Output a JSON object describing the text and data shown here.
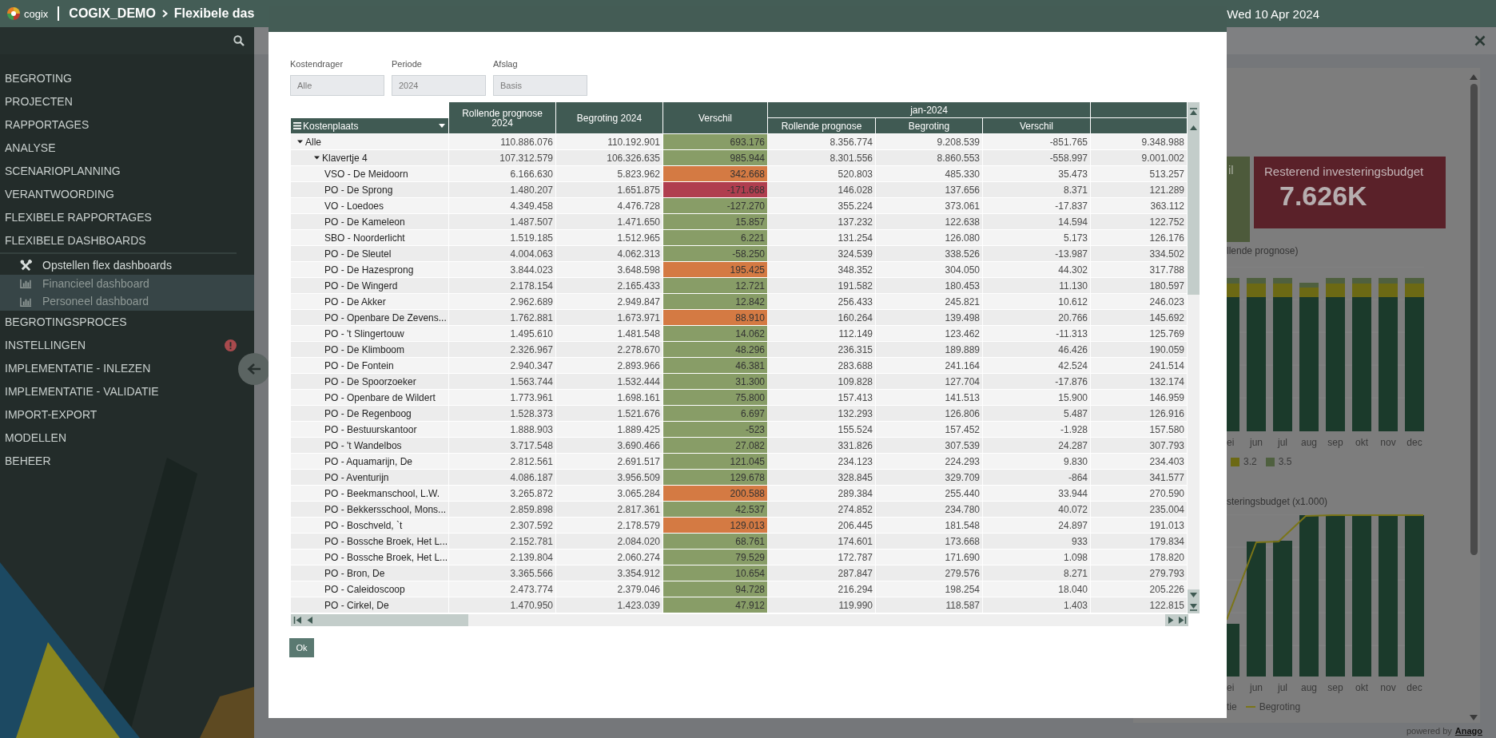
{
  "top_bar": {
    "logo_text": "cogix",
    "environment": "COGIX_DEMO",
    "page_title": "Flexibele das",
    "date": "Wed 10 Apr 2024"
  },
  "sidebar": {
    "items": [
      {
        "label": "BEGROTING",
        "alert": false
      },
      {
        "label": "PROJECTEN",
        "alert": false
      },
      {
        "label": "RAPPORTAGES",
        "alert": false
      },
      {
        "label": "ANALYSE",
        "alert": false
      },
      {
        "label": "SCENARIOPLANNING",
        "alert": false
      },
      {
        "label": "VERANTWOORDING",
        "alert": false
      },
      {
        "label": "FLEXIBELE RAPPORTAGES",
        "alert": false
      },
      {
        "label": "FLEXIBELE DASHBOARDS",
        "alert": false,
        "children": [
          {
            "label": "Opstellen flex dashboards",
            "kind": "tool",
            "selected": false
          },
          {
            "label": "Financieel dashboard",
            "kind": "chart",
            "selected": true
          },
          {
            "label": "Personeel dashboard",
            "kind": "chart",
            "selected": true
          }
        ]
      },
      {
        "label": "BEGROTINGSPROCES",
        "alert": false
      },
      {
        "label": "INSTELLINGEN",
        "alert": true
      },
      {
        "label": "IMPLEMENTATIE - INLEZEN",
        "alert": false
      },
      {
        "label": "IMPLEMENTATIE - VALIDATIE",
        "alert": false
      },
      {
        "label": "IMPORT-EXPORT",
        "alert": false
      },
      {
        "label": "MODELLEN",
        "alert": false
      },
      {
        "label": "BEHEER",
        "alert": false
      }
    ]
  },
  "dashboard": {
    "kpi_cards": [
      {
        "title": "il",
        "color": "#4d5a3b"
      },
      {
        "title": "Resterend investeringsbudget",
        "value": "7.626K",
        "color": "#5a2129"
      }
    ],
    "charts": [
      {
        "kind": "stacked",
        "title": "llende prognose)",
        "months": [
          "ei",
          "jun",
          "jul",
          "aug",
          "sep",
          "okt",
          "nov",
          "dec"
        ],
        "legend": [
          {
            "label": "3.2",
            "kind": "box",
            "color": "#6c6914"
          },
          {
            "label": "3.5",
            "kind": "box",
            "color": "#4f603f"
          }
        ]
      },
      {
        "kind": "combo",
        "title": "steringsbudget (x1.000)",
        "months": [
          "ei",
          "jun",
          "jul",
          "aug",
          "sep",
          "okt",
          "nov",
          "dec"
        ],
        "legend": [
          {
            "label": "tie",
            "kind": "text"
          },
          {
            "label": "Begroting",
            "kind": "line",
            "color": "#7b7518"
          }
        ]
      }
    ],
    "footer": {
      "prefix": "powered by",
      "link": "Anago"
    }
  },
  "modal": {
    "filters": [
      {
        "label": "Kostendrager",
        "value": "Alle"
      },
      {
        "label": "Periode",
        "value": "2024"
      },
      {
        "label": "Afslag",
        "value": "Basis"
      }
    ],
    "table": {
      "row_header": "Kostenplaats",
      "columns": [
        "Rollende prognose 2024",
        "Begroting 2024",
        "Verschil"
      ],
      "group_header": "jan-2024",
      "group_columns": [
        "Rollende prognose",
        "Begroting",
        "Verschil"
      ],
      "rows": [
        {
          "name": "Alle",
          "expanded": true,
          "values": [
            "110.886.076",
            "110.192.901",
            "693.176",
            "8.356.774",
            "9.208.539",
            "-851.765",
            "9.348.988"
          ],
          "color": "#889d67",
          "children": [
            {
              "name": "Klavertje 4",
              "expanded": true,
              "values": [
                "107.312.579",
                "106.326.635",
                "985.944",
                "8.301.556",
                "8.860.553",
                "-558.997",
                "9.001.002"
              ],
              "color": "#889d67",
              "children": [
                {
                  "name": "VSO - De Meidoorn",
                  "values": [
                    "6.166.630",
                    "5.823.962",
                    "342.668",
                    "520.803",
                    "485.330",
                    "35.473",
                    "513.257"
                  ],
                  "color": "#d47a43"
                },
                {
                  "name": "PO - De Sprong",
                  "values": [
                    "1.480.207",
                    "1.651.875",
                    "-171.668",
                    "146.028",
                    "137.656",
                    "8.371",
                    "121.289"
                  ],
                  "color": "#b03e4f"
                },
                {
                  "name": "VO - Loedoes",
                  "values": [
                    "4.349.458",
                    "4.476.728",
                    "-127.270",
                    "355.224",
                    "373.061",
                    "-17.837",
                    "363.112"
                  ],
                  "color": "#889d67"
                },
                {
                  "name": "PO - De Kameleon",
                  "values": [
                    "1.487.507",
                    "1.471.650",
                    "15.857",
                    "137.232",
                    "122.638",
                    "14.594",
                    "122.752"
                  ],
                  "color": "#889d67"
                },
                {
                  "name": "SBO - Noorderlicht",
                  "values": [
                    "1.519.185",
                    "1.512.965",
                    "6.221",
                    "131.254",
                    "126.080",
                    "5.173",
                    "126.176"
                  ],
                  "color": "#889d67"
                },
                {
                  "name": "PO - De Sleutel",
                  "values": [
                    "4.004.063",
                    "4.062.313",
                    "-58.250",
                    "324.539",
                    "338.526",
                    "-13.987",
                    "334.502"
                  ],
                  "color": "#889d67"
                },
                {
                  "name": "PO - De Hazesprong",
                  "values": [
                    "3.844.023",
                    "3.648.598",
                    "195.425",
                    "348.352",
                    "304.050",
                    "44.302",
                    "317.788"
                  ],
                  "color": "#d47a43"
                },
                {
                  "name": "PO - De Wingerd",
                  "values": [
                    "2.178.154",
                    "2.165.433",
                    "12.721",
                    "191.582",
                    "180.453",
                    "11.130",
                    "180.597"
                  ],
                  "color": "#889d67"
                },
                {
                  "name": "PO - De Akker",
                  "values": [
                    "2.962.689",
                    "2.949.847",
                    "12.842",
                    "256.433",
                    "245.821",
                    "10.612",
                    "246.023"
                  ],
                  "color": "#889d67"
                },
                {
                  "name": "PO - Openbare De Zevens...",
                  "values": [
                    "1.762.881",
                    "1.673.971",
                    "88.910",
                    "160.264",
                    "139.498",
                    "20.766",
                    "145.692"
                  ],
                  "color": "#d47a43"
                },
                {
                  "name": "PO - 't Slingertouw",
                  "values": [
                    "1.495.610",
                    "1.481.548",
                    "14.062",
                    "112.149",
                    "123.462",
                    "-11.313",
                    "125.769"
                  ],
                  "color": "#889d67"
                },
                {
                  "name": "PO - De Klimboom",
                  "values": [
                    "2.326.967",
                    "2.278.670",
                    "48.296",
                    "236.315",
                    "189.889",
                    "46.426",
                    "190.059"
                  ],
                  "color": "#889d67"
                },
                {
                  "name": "PO - De Fontein",
                  "values": [
                    "2.940.347",
                    "2.893.966",
                    "46.381",
                    "283.688",
                    "241.164",
                    "42.524",
                    "241.514"
                  ],
                  "color": "#889d67"
                },
                {
                  "name": "PO - De Spoorzoeker",
                  "values": [
                    "1.563.744",
                    "1.532.444",
                    "31.300",
                    "109.828",
                    "127.704",
                    "-17.876",
                    "132.174"
                  ],
                  "color": "#889d67"
                },
                {
                  "name": "PO - Openbare de Wildert",
                  "values": [
                    "1.773.961",
                    "1.698.161",
                    "75.800",
                    "157.413",
                    "141.513",
                    "15.900",
                    "146.959"
                  ],
                  "color": "#889d67"
                },
                {
                  "name": "PO - De Regenboog",
                  "values": [
                    "1.528.373",
                    "1.521.676",
                    "6.697",
                    "132.293",
                    "126.806",
                    "5.487",
                    "126.916"
                  ],
                  "color": "#889d67"
                },
                {
                  "name": "PO - Bestuurskantoor",
                  "values": [
                    "1.888.903",
                    "1.889.425",
                    "-523",
                    "155.524",
                    "157.452",
                    "-1.928",
                    "157.580"
                  ],
                  "color": "#889d67"
                },
                {
                  "name": "PO - 't Wandelbos",
                  "values": [
                    "3.717.548",
                    "3.690.466",
                    "27.082",
                    "331.826",
                    "307.539",
                    "24.287",
                    "307.793"
                  ],
                  "color": "#889d67"
                },
                {
                  "name": "PO - Aquamarijn, De",
                  "values": [
                    "2.812.561",
                    "2.691.517",
                    "121.045",
                    "234.123",
                    "224.293",
                    "9.830",
                    "234.403"
                  ],
                  "color": "#889d67"
                },
                {
                  "name": "PO - Aventurijn",
                  "values": [
                    "4.086.187",
                    "3.956.509",
                    "129.678",
                    "328.845",
                    "329.709",
                    "-864",
                    "341.577"
                  ],
                  "color": "#889d67"
                },
                {
                  "name": "PO - Beekmanschool, L.W.",
                  "values": [
                    "3.265.872",
                    "3.065.284",
                    "200.588",
                    "289.384",
                    "255.440",
                    "33.944",
                    "270.590"
                  ],
                  "color": "#d47a43"
                },
                {
                  "name": "PO - Bekkersschool, Mons...",
                  "values": [
                    "2.859.898",
                    "2.817.361",
                    "42.537",
                    "274.852",
                    "234.780",
                    "40.072",
                    "235.004"
                  ],
                  "color": "#889d67"
                },
                {
                  "name": "PO - Boschveld, `t",
                  "values": [
                    "2.307.592",
                    "2.178.579",
                    "129.013",
                    "206.445",
                    "181.548",
                    "24.897",
                    "191.013"
                  ],
                  "color": "#d47a43"
                },
                {
                  "name": "PO - Bossche Broek, Het L...",
                  "values": [
                    "2.152.781",
                    "2.084.020",
                    "68.761",
                    "174.601",
                    "173.668",
                    "933",
                    "179.834"
                  ],
                  "color": "#889d67"
                },
                {
                  "name": "PO - Bossche Broek, Het L...",
                  "values": [
                    "2.139.804",
                    "2.060.274",
                    "79.529",
                    "172.787",
                    "171.690",
                    "1.098",
                    "178.820"
                  ],
                  "color": "#889d67"
                },
                {
                  "name": "PO - Bron, De",
                  "values": [
                    "3.365.566",
                    "3.354.912",
                    "10.654",
                    "287.847",
                    "279.576",
                    "8.271",
                    "279.793"
                  ],
                  "color": "#889d67"
                },
                {
                  "name": "PO - Caleidoscoop",
                  "values": [
                    "2.473.774",
                    "2.379.046",
                    "94.728",
                    "216.294",
                    "198.254",
                    "18.040",
                    "205.226"
                  ],
                  "color": "#889d67"
                },
                {
                  "name": "PO - Cirkel, De",
                  "values": [
                    "1.470.950",
                    "1.423.039",
                    "47.912",
                    "119.990",
                    "118.587",
                    "1.403",
                    "122.815"
                  ],
                  "color": "#889d67"
                }
              ]
            }
          ]
        }
      ]
    },
    "ok_button": "Ok"
  }
}
